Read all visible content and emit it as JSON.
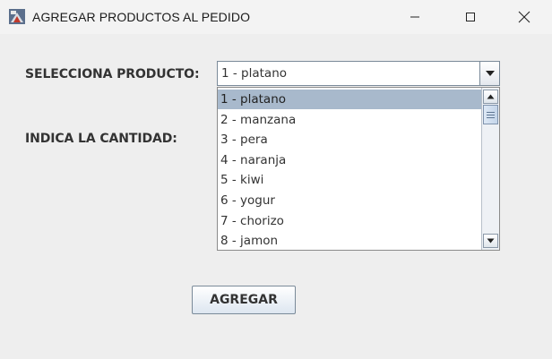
{
  "window": {
    "title": "AGREGAR PRODUCTOS AL PEDIDO",
    "icons": {
      "app": "java-app-icon",
      "minimize": "minimize-icon",
      "maximize": "maximize-icon",
      "close": "close-icon"
    }
  },
  "form": {
    "product_label": "SELECCIONA PRODUCTO:",
    "quantity_label": "INDICA LA CANTIDAD:",
    "product_selected": "1 - platano",
    "product_options": [
      "1 - platano",
      "2 - manzana",
      "3 - pera",
      "4 - naranja",
      "5 - kiwi",
      "6 - yogur",
      "7 - chorizo",
      "8 - jamon"
    ],
    "highlighted_index": 0,
    "add_button": "AGREGAR"
  },
  "colors": {
    "background": "#eeeeee",
    "selection": "#a8b9cc",
    "border": "#7a8a99"
  }
}
